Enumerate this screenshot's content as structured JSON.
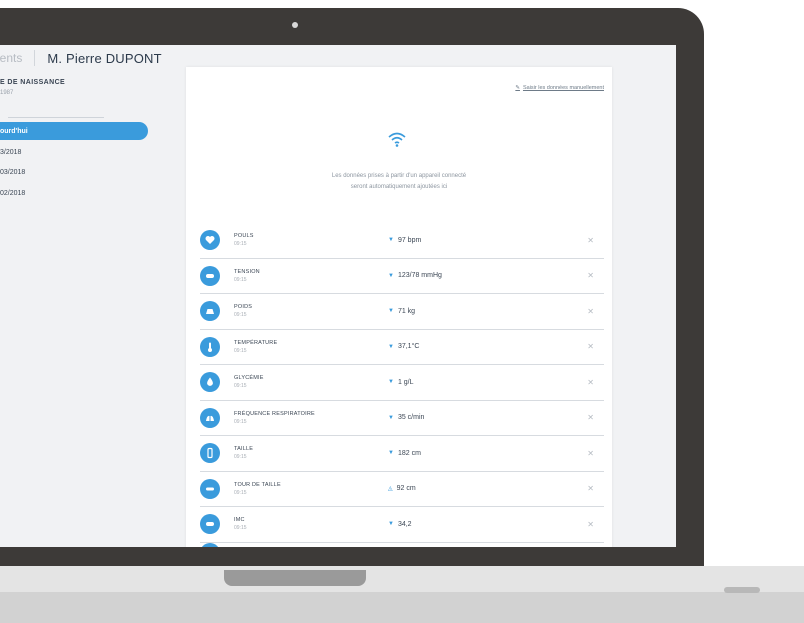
{
  "breadcrumb": {
    "prev": "ients",
    "patient_name": "M. Pierre DUPONT"
  },
  "sidebar": {
    "label": "E DE NAISSANCE",
    "sub": "1987",
    "active_item": "ourd'hui",
    "dates": [
      "3/2018",
      "03/2018",
      "02/2018"
    ]
  },
  "card": {
    "link_text": "Saisir les données manuellement",
    "message_line1": "Les données prises à partir d'un appareil connecté",
    "message_line2": "seront automatiquement ajoutées ici",
    "rows": [
      {
        "name": "Pouls",
        "time": "09:15",
        "arrow": "▼",
        "value": "97 bpm",
        "icon": "heart-icon"
      },
      {
        "name": "Tension",
        "time": "09:15",
        "arrow": "▼",
        "value": "123/78 mmHg",
        "icon": "blood-pressure-icon"
      },
      {
        "name": "Poids",
        "time": "09:15",
        "arrow": "▼",
        "value": "71 kg",
        "icon": "scale-icon"
      },
      {
        "name": "Température",
        "time": "09:15",
        "arrow": "▼",
        "value": "37,1°C",
        "icon": "thermometer-icon"
      },
      {
        "name": "Glycémie",
        "time": "09:15",
        "arrow": "▼",
        "value": "1 g/L",
        "icon": "drop-icon"
      },
      {
        "name": "Fréquence respiratoire",
        "time": "09:15",
        "arrow": "▼",
        "value": "35 c/min",
        "icon": "lungs-icon"
      },
      {
        "name": "Taille",
        "time": "09:15",
        "arrow": "▼",
        "value": "182 cm",
        "icon": "ruler-icon"
      },
      {
        "name": "Tour de taille",
        "time": "09:15",
        "arrow": "◬",
        "value": "92 cm",
        "icon": "tape-icon"
      },
      {
        "name": "IMC",
        "time": "09:15",
        "arrow": "▼",
        "value": "34,2",
        "icon": "bmi-icon"
      }
    ]
  },
  "colors": {
    "accent": "#3a9bdc",
    "bezel": "#3d3a38",
    "screen_bg": "#f1f2f4"
  }
}
